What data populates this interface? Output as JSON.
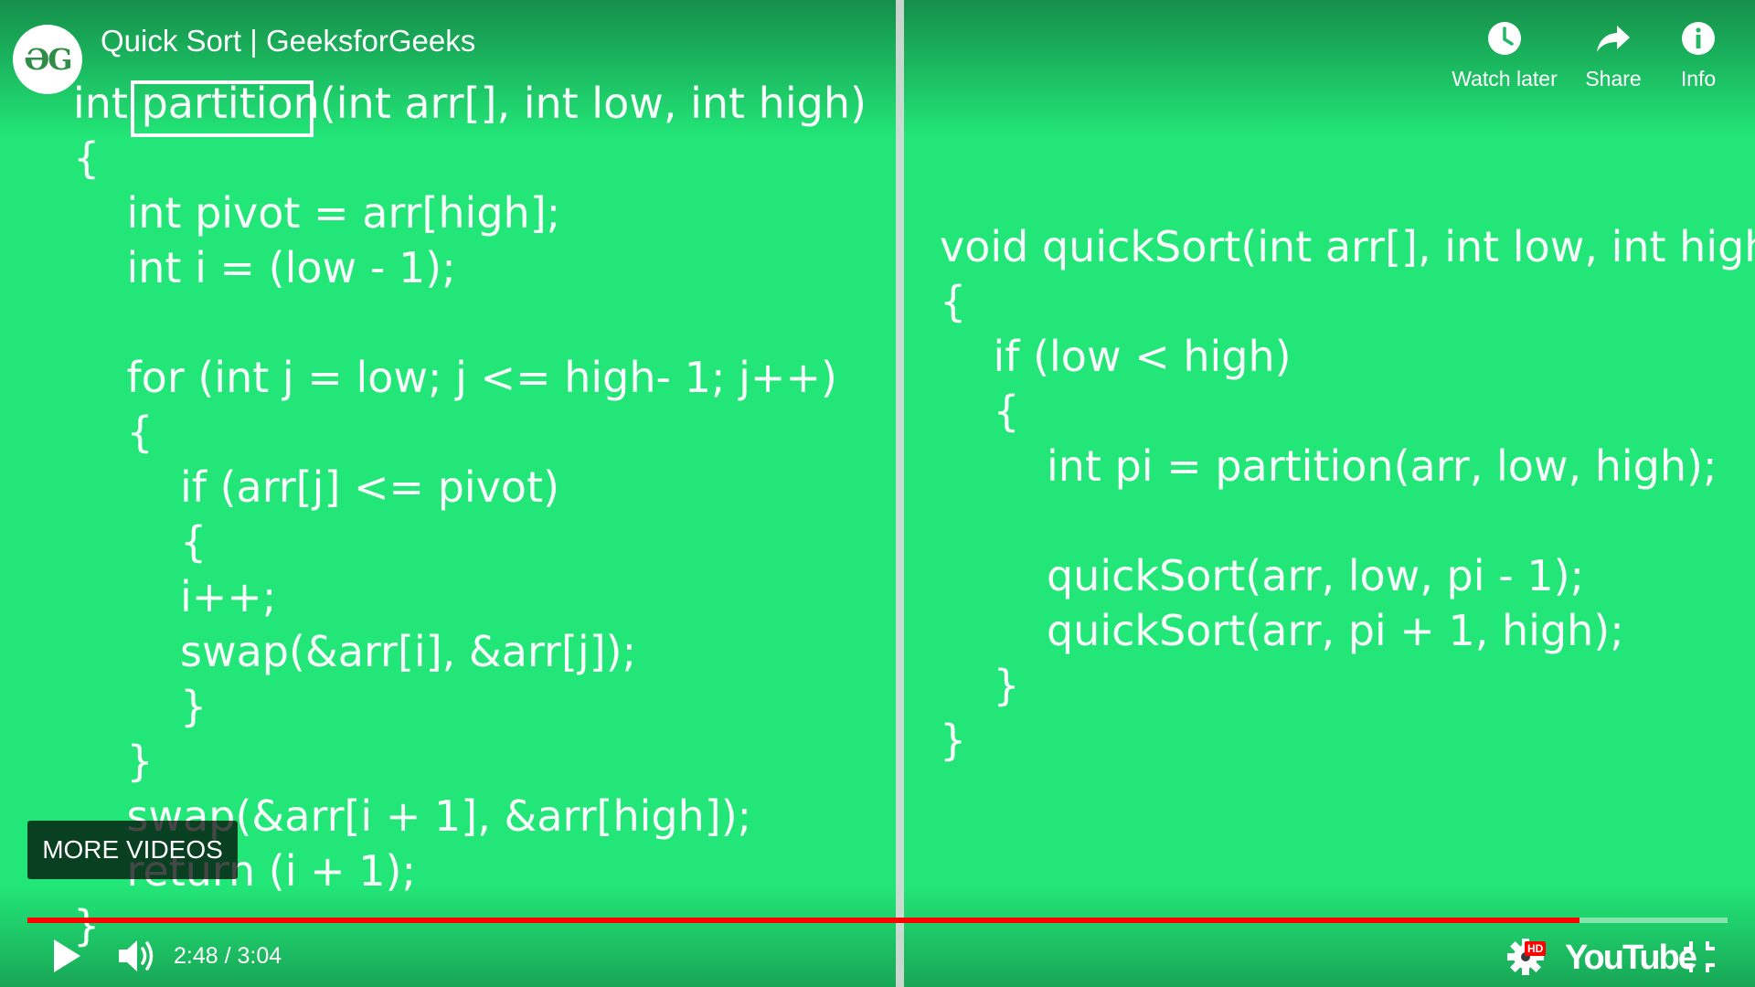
{
  "header": {
    "logo_text": "ƏG",
    "title": "Quick Sort | GeeksforGeeks",
    "actions": [
      {
        "label": "Watch later",
        "icon": "clock-icon"
      },
      {
        "label": "Share",
        "icon": "share-arrow-icon"
      },
      {
        "label": "Info",
        "icon": "info-icon"
      }
    ]
  },
  "code_left": [
    "int partition(int arr[], int low, int high)",
    "{",
    "    int pivot = arr[high];",
    "    int i = (low - 1);",
    "",
    "    for (int j = low; j <= high- 1; j++)",
    "    {",
    "        if (arr[j] <= pivot)",
    "        {",
    "        i++;",
    "        swap(&arr[i], &arr[j]);",
    "        }",
    "    }",
    "    swap(&arr[i + 1], &arr[high]);",
    "    return (i + 1);",
    "}"
  ],
  "code_right": [
    "void quickSort(int arr[], int low, int high)",
    "{",
    "    if (low < high)",
    "    {",
    "        int pi = partition(arr, low, high);",
    "",
    "        quickSort(arr, low, pi - 1);",
    "        quickSort(arr, pi + 1, high);",
    "    }",
    "}"
  ],
  "overlay": {
    "more_videos_label": "MORE VIDEOS"
  },
  "player": {
    "current_time": "2:48",
    "duration": "3:04",
    "time_display": "2:48 / 3:04",
    "progress_fraction": 0.913,
    "quality_badge": "HD",
    "brand_label": "YouTube"
  },
  "colors": {
    "background": "#22e677",
    "progress": "#ff0000",
    "logo_green": "#2f8d46"
  }
}
